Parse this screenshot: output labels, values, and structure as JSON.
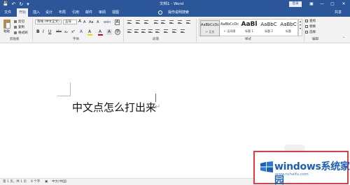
{
  "window": {
    "title": "文档1 - Word",
    "login_label": "登录",
    "controls": [
      "▣",
      "—",
      "▢",
      "✕"
    ]
  },
  "qat": {
    "save": "💾",
    "undo": "↶",
    "redo": "↻",
    "customize": "▾"
  },
  "tabs": [
    {
      "label": "文件",
      "active": false
    },
    {
      "label": "开始",
      "active": true
    },
    {
      "label": "插入",
      "active": false
    },
    {
      "label": "设计",
      "active": false
    },
    {
      "label": "布局",
      "active": false
    },
    {
      "label": "引用",
      "active": false
    },
    {
      "label": "邮件",
      "active": false
    },
    {
      "label": "审阅",
      "active": false
    },
    {
      "label": "视图",
      "active": false
    }
  ],
  "tell_me": "操作说明搜索",
  "share_label": "共享",
  "clipboard": {
    "paste": "粘贴",
    "cut": "剪切",
    "copy": "复制",
    "format_painter": "格式刷",
    "group": "剪贴板"
  },
  "font": {
    "family": "等线 (中文正文)",
    "size": "五号",
    "bold": "B",
    "italic": "I",
    "underline": "U",
    "strike": "abc",
    "subscript": "x₂",
    "superscript": "x²",
    "grow": "A",
    "shrink": "A",
    "case": "Aa",
    "clear": "A",
    "wen": "wén",
    "highlight": "A",
    "color": "A",
    "group": "字体"
  },
  "paragraph": {
    "group": "段落"
  },
  "styles": {
    "items": [
      {
        "sample": "AaBbCcDc",
        "name": "↵ 正文",
        "selected": true
      },
      {
        "sample": "AaBbCcDc",
        "name": "↵ 无间隔",
        "selected": false
      },
      {
        "sample": "AaBl",
        "name": "标题 1",
        "selected": false
      },
      {
        "sample": "AaBbC",
        "name": "标题 2",
        "selected": false
      },
      {
        "sample": "AaBbC",
        "name": "标题",
        "selected": false
      }
    ],
    "group": "样式"
  },
  "editing": {
    "find": "查找",
    "replace": "替换",
    "select": "选择",
    "group": "编辑"
  },
  "document": {
    "text": "中文点怎么打出来",
    "paragraph_mark": "↵"
  },
  "status": {
    "page": "第 1 页，共 1 页",
    "words": "8 个字",
    "language": "中文(中国)"
  },
  "watermark": {
    "brand": "windows系统家园",
    "url": "www.ruhaifu.com"
  },
  "colors": {
    "accent": "#2b579a",
    "ribbon": "#f3f3f3",
    "watermark_frame": "#e03c3c",
    "watermark_text": "#1d5fb6"
  }
}
